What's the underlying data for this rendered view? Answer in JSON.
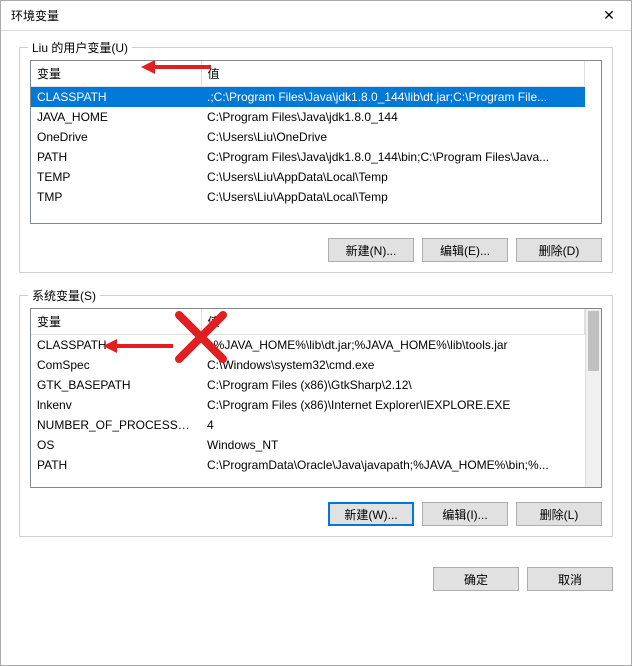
{
  "window": {
    "title": "环境变量"
  },
  "user_vars": {
    "label": "Liu 的用户变量(U)",
    "columns": {
      "name": "变量",
      "value": "值"
    },
    "rows": [
      {
        "name": "CLASSPATH",
        "value": ".;C:\\Program Files\\Java\\jdk1.8.0_144\\lib\\dt.jar;C:\\Program File..."
      },
      {
        "name": "JAVA_HOME",
        "value": "C:\\Program Files\\Java\\jdk1.8.0_144"
      },
      {
        "name": "OneDrive",
        "value": "C:\\Users\\Liu\\OneDrive"
      },
      {
        "name": "PATH",
        "value": "C:\\Program Files\\Java\\jdk1.8.0_144\\bin;C:\\Program Files\\Java..."
      },
      {
        "name": "TEMP",
        "value": "C:\\Users\\Liu\\AppData\\Local\\Temp"
      },
      {
        "name": "TMP",
        "value": "C:\\Users\\Liu\\AppData\\Local\\Temp"
      }
    ],
    "buttons": {
      "new": "新建(N)...",
      "edit": "编辑(E)...",
      "delete": "删除(D)"
    }
  },
  "system_vars": {
    "label": "系统变量(S)",
    "columns": {
      "name": "变量",
      "value": "值"
    },
    "rows": [
      {
        "name": "CLASSPATH",
        "value": ".;%JAVA_HOME%\\lib\\dt.jar;%JAVA_HOME%\\lib\\tools.jar"
      },
      {
        "name": "ComSpec",
        "value": "C:\\Windows\\system32\\cmd.exe"
      },
      {
        "name": "GTK_BASEPATH",
        "value": "C:\\Program Files (x86)\\GtkSharp\\2.12\\"
      },
      {
        "name": "lnkenv",
        "value": "C:\\Program Files (x86)\\Internet Explorer\\IEXPLORE.EXE"
      },
      {
        "name": "NUMBER_OF_PROCESSORS",
        "value": "4"
      },
      {
        "name": "OS",
        "value": "Windows_NT"
      },
      {
        "name": "PATH",
        "value": "C:\\ProgramData\\Oracle\\Java\\javapath;%JAVA_HOME%\\bin;%..."
      }
    ],
    "buttons": {
      "new": "新建(W)...",
      "edit": "编辑(I)...",
      "delete": "删除(L)"
    }
  },
  "footer": {
    "ok": "确定",
    "cancel": "取消"
  }
}
